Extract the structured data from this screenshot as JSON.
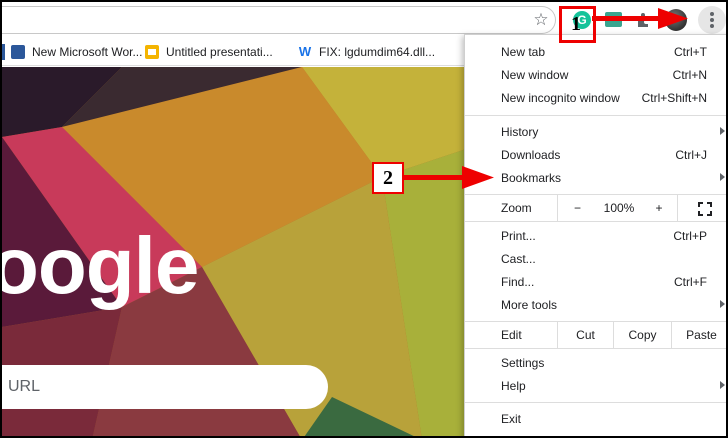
{
  "toolbar": {
    "grammarly_letter": "G",
    "icons": [
      "star-icon",
      "grammarly-extension-icon",
      "extension-icon",
      "puzzle-icon",
      "profile-avatar",
      "more-vert-icon"
    ]
  },
  "bookmarks": [
    {
      "label": "New Microsoft Wor...",
      "icon": "word-doc-icon"
    },
    {
      "label": "Untitled presentati...",
      "icon": "slides-icon"
    },
    {
      "label": "FIX: lgdumdim64.dll...",
      "icon": "w-site-icon"
    }
  ],
  "page": {
    "logo_text": "oogle",
    "search_placeholder": "URL"
  },
  "callouts": {
    "one": "1",
    "two": "2",
    "color": "#ee0000"
  },
  "menu": {
    "new_tab": {
      "label": "New tab",
      "shortcut": "Ctrl+T"
    },
    "new_window": {
      "label": "New window",
      "shortcut": "Ctrl+N"
    },
    "new_incognito": {
      "label": "New incognito window",
      "shortcut": "Ctrl+Shift+N"
    },
    "history": {
      "label": "History"
    },
    "downloads": {
      "label": "Downloads",
      "shortcut": "Ctrl+J"
    },
    "bookmarks": {
      "label": "Bookmarks"
    },
    "zoom": {
      "label": "Zoom",
      "minus": "−",
      "value": "100%",
      "plus": "+"
    },
    "print": {
      "label": "Print...",
      "shortcut": "Ctrl+P"
    },
    "cast": {
      "label": "Cast..."
    },
    "find": {
      "label": "Find...",
      "shortcut": "Ctrl+F"
    },
    "more_tools": {
      "label": "More tools"
    },
    "edit": {
      "label": "Edit",
      "cut": "Cut",
      "copy": "Copy",
      "paste": "Paste"
    },
    "settings": {
      "label": "Settings"
    },
    "help": {
      "label": "Help"
    },
    "exit": {
      "label": "Exit"
    }
  }
}
